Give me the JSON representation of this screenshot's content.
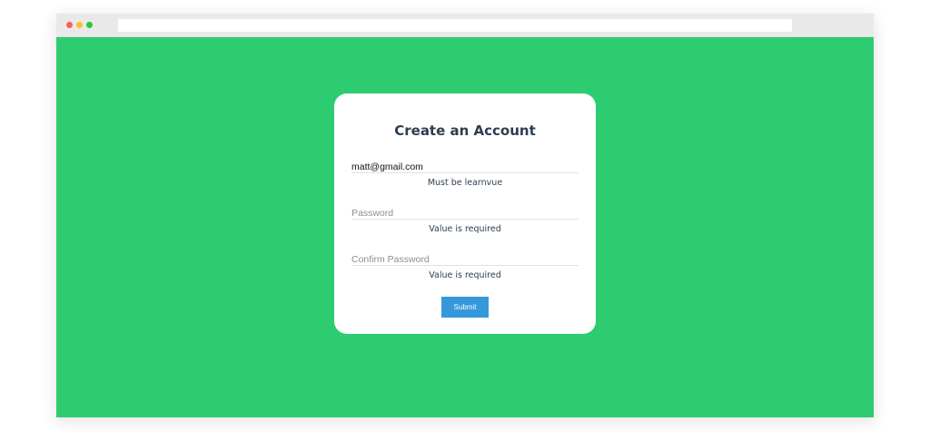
{
  "browser": {
    "traffic_lights": [
      "red",
      "yellow",
      "green"
    ],
    "colors": {
      "background": "#2ecc71",
      "chrome": "#e9e9e9"
    }
  },
  "form": {
    "title": "Create an Account",
    "email": {
      "value": "matt@gmail.com",
      "error": "Must be learnvue"
    },
    "password": {
      "placeholder": "Password",
      "error": "Value is required"
    },
    "confirm_password": {
      "placeholder": "Confirm Password",
      "error": "Value is required"
    },
    "submit_label": "Submit",
    "colors": {
      "accent": "#3498db",
      "text": "#2c3e50"
    }
  }
}
